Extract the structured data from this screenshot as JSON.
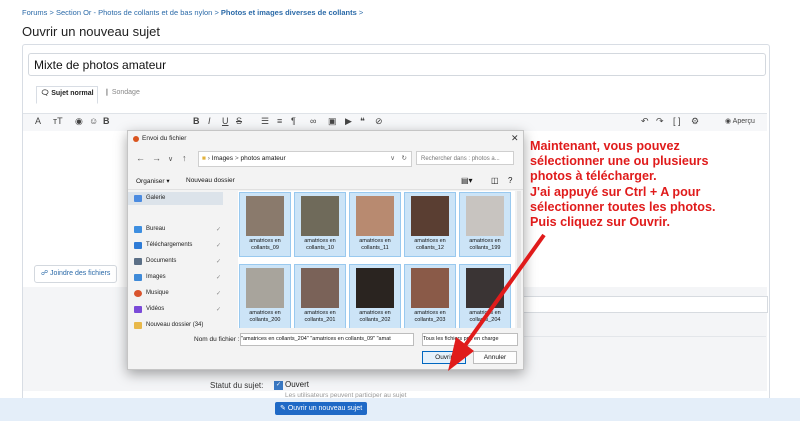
{
  "breadcrumb": {
    "part1": "Forums",
    "sep": ">",
    "part2": "Section Or - Photos de collants et de bas nylon",
    "part3": "Photos et images diverses de collants"
  },
  "page_title": "Ouvrir un nouveau sujet",
  "subject_value": "Mixte de photos amateur",
  "tabs": {
    "sujet": "Sujet normal",
    "sondage": "Sondage"
  },
  "toolbar": {
    "font": "A",
    "size": "тT",
    "preview": "Aperçu"
  },
  "attach_label": "Joindre des fichiers",
  "status": {
    "label": "Statut du sujet:",
    "open": "Ouvert",
    "sub": "Les utilisateurs peuvent participer au sujet"
  },
  "submit_label": "Ouvrir un nouveau sujet",
  "dialog": {
    "title": "Envoi du fichier",
    "path": [
      "Images",
      ">",
      "photos amateur"
    ],
    "search_placeholder": "Rechercher dans : photos a...",
    "organize": "Organiser",
    "new_folder": "Nouveau dossier",
    "sidebar": [
      {
        "label": "Galerie",
        "color": "#4b8be0"
      },
      {
        "label": "Bureau",
        "color": "#3d8ee0"
      },
      {
        "label": "Téléchargements",
        "color": "#2e7bd6"
      },
      {
        "label": "Documents",
        "color": "#5b6f86"
      },
      {
        "label": "Images",
        "color": "#3f8ad8"
      },
      {
        "label": "Musique",
        "color": "#d9542d"
      },
      {
        "label": "Vidéos",
        "color": "#7a4ad8"
      },
      {
        "label": "Nouveau dossier (34)",
        "color": "#e8b84a"
      }
    ],
    "files": [
      {
        "label": "amatrices en collants_09",
        "color": "#8a7a6c"
      },
      {
        "label": "amatrices en collants_10",
        "color": "#6f6a5a"
      },
      {
        "label": "amatrices en collants_11",
        "color": "#b88a70"
      },
      {
        "label": "amatrices en collants_12",
        "color": "#5a3e32"
      },
      {
        "label": "amatrices en collants_199",
        "color": "#c8c4c0"
      },
      {
        "label": "amatrices en collants_200",
        "color": "#a8a49c"
      },
      {
        "label": "amatrices en collants_201",
        "color": "#7a6258"
      },
      {
        "label": "amatrices en collants_202",
        "color": "#2a2420"
      },
      {
        "label": "amatrices en collants_203",
        "color": "#8a5a48"
      },
      {
        "label": "amatrices en collants_204",
        "color": "#3a3434"
      }
    ],
    "filename_label": "Nom du fichier :",
    "filename_value": "\"amatrices en collants_204\" \"amatrices en collants_09\" \"amat",
    "filetype": "Tous les fichiers pris en charge",
    "open": "Ouvrir",
    "cancel": "Annuler"
  },
  "annotation": [
    "Maintenant, vous pouvez",
    "sélectionner une ou plusieurs",
    "photos à télécharger.",
    "J'ai appuyé sur Ctrl + A pour",
    "sélectionner toutes les photos.",
    "Puis cliquez sur Ouvrir."
  ],
  "colors": {
    "accent": "#1f69c6",
    "annotation": "#e01b1b",
    "selection": "#cce4f7"
  }
}
